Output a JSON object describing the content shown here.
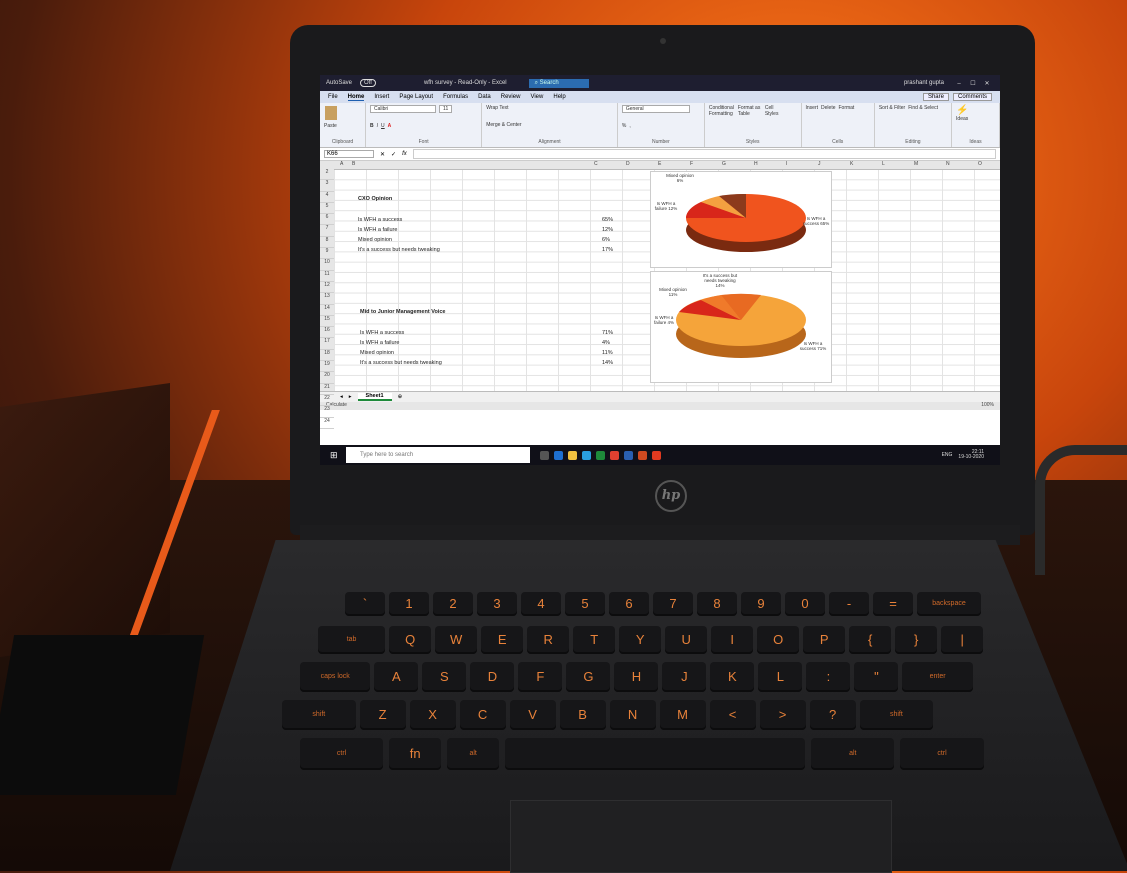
{
  "window": {
    "autosave_label": "AutoSave",
    "autosave_state": "Off",
    "title": "wfh survey - Read-Only - Excel",
    "search_label": "Search",
    "user": "prashant gupta"
  },
  "ribbon": {
    "tabs": [
      "File",
      "Home",
      "Insert",
      "Page Layout",
      "Formulas",
      "Data",
      "Review",
      "View",
      "Help"
    ],
    "active_tab": "Home",
    "share_label": "Share",
    "comments_label": "Comments",
    "font_name": "Calibri",
    "font_size": "11",
    "wrap_text": "Wrap Text",
    "merge_center": "Merge & Center",
    "number_format": "General",
    "conditional_formatting": "Conditional Formatting",
    "format_as_table": "Format as Table",
    "cell_styles": "Cell Styles",
    "insert": "Insert",
    "delete": "Delete",
    "format": "Format",
    "sort_filter": "Sort & Filter",
    "find_select": "Find & Select",
    "ideas": "Ideas",
    "groups": [
      "Clipboard",
      "Font",
      "Alignment",
      "Number",
      "Styles",
      "Cells",
      "Editing",
      "Ideas"
    ],
    "paste": "Paste"
  },
  "formula_bar": {
    "name_box": "K66",
    "fx": "fx"
  },
  "columns": [
    "A",
    "B",
    "C",
    "D",
    "E",
    "F",
    "G",
    "H",
    "I",
    "J",
    "K",
    "L",
    "M",
    "N",
    "O"
  ],
  "rows": [
    "2",
    "3",
    "4",
    "5",
    "6",
    "7",
    "8",
    "9",
    "10",
    "11",
    "12",
    "13",
    "14",
    "15",
    "16",
    "17",
    "18",
    "19",
    "20",
    "21",
    "22",
    "23",
    "24"
  ],
  "sheet": {
    "cxo_title": "CXO Opinion",
    "cxo_items": [
      {
        "label": "Is WFH a success",
        "value": "65%"
      },
      {
        "label": "Is WFH a failure",
        "value": "12%"
      },
      {
        "label": "Mixed opinion",
        "value": "6%"
      },
      {
        "label": "It's a success but needs tweaking",
        "value": "17%"
      }
    ],
    "mid_title": "Mid to Junior Management Voice",
    "mid_items": [
      {
        "label": "Is WFH a success",
        "value": "71%"
      },
      {
        "label": "Is WFH a failure",
        "value": "4%"
      },
      {
        "label": "Mixed opinion",
        "value": "11%"
      },
      {
        "label": "It's a success but needs tweaking",
        "value": "14%"
      }
    ]
  },
  "chart1_labels": {
    "mixed": "Mixed opinion 6%",
    "failure": "Is WFH a failure 12%",
    "success": "Is WFH a success 65%"
  },
  "chart2_labels": {
    "tweak": "It's a success but needs tweaking 14%",
    "mixed": "Mixed opinion 11%",
    "failure": "Is WFH a failure 4%",
    "success": "Is WFH a success 71%"
  },
  "sheet_tab": "Sheet1",
  "status": "Calculate",
  "zoom": "100%",
  "taskbar": {
    "search_placeholder": "Type here to search",
    "lang": "ENG",
    "time": "22:11",
    "date": "19-10-2020"
  },
  "brand": "hp",
  "keyboard": {
    "row1": [
      "`",
      "1",
      "2",
      "3",
      "4",
      "5",
      "6",
      "7",
      "8",
      "9",
      "0",
      "-",
      "=",
      "backspace"
    ],
    "row2": [
      "tab",
      "Q",
      "W",
      "E",
      "R",
      "T",
      "Y",
      "U",
      "I",
      "O",
      "P",
      "{",
      "}",
      "|"
    ],
    "row3": [
      "caps lock",
      "A",
      "S",
      "D",
      "F",
      "G",
      "H",
      "J",
      "K",
      "L",
      ":",
      "\"",
      "enter"
    ],
    "row4": [
      "shift",
      "Z",
      "X",
      "C",
      "V",
      "B",
      "N",
      "M",
      "<",
      ">",
      "?",
      "shift"
    ],
    "row5": [
      "ctrl",
      "fn",
      "alt",
      "alt",
      "ctrl"
    ]
  },
  "colors": {
    "pie_success_1": "#f0541e",
    "pie_failure_1": "#d8261a",
    "pie_mixed_1": "#f4a040",
    "pie_tweak_1": "#8c3a1c",
    "pie_success_2": "#f5a43a",
    "excel_green": "#1e8a3a"
  }
}
